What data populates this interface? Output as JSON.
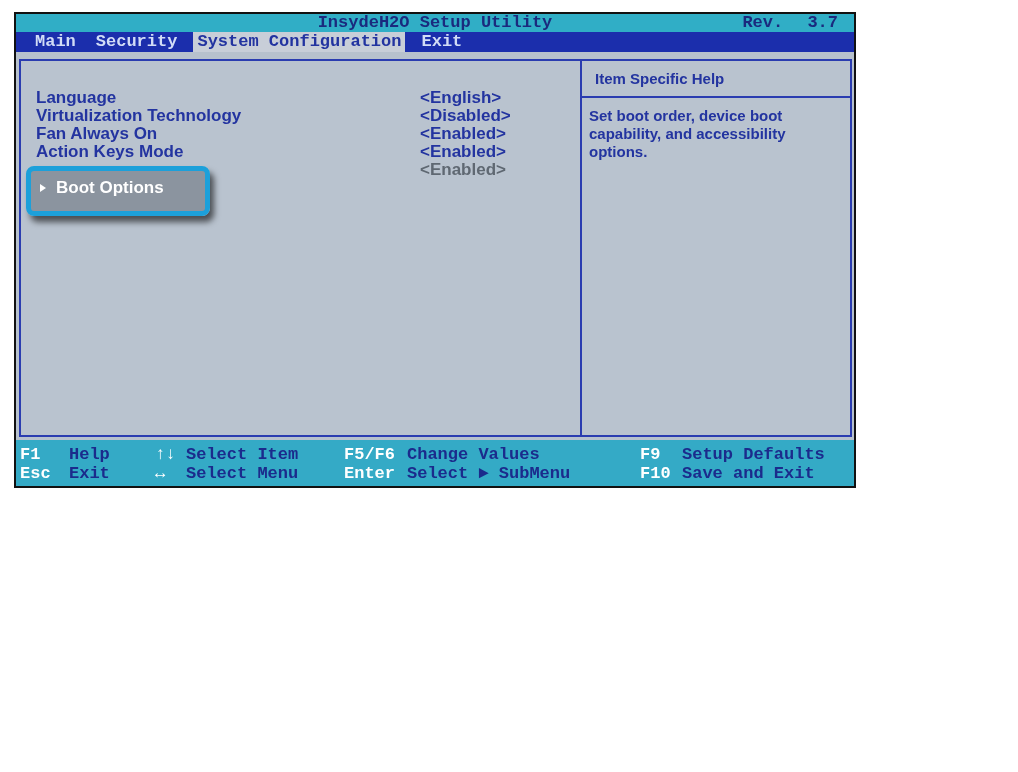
{
  "title_bar": {
    "title": "InsydeH2O Setup Utility",
    "revision": "Rev. 3.7"
  },
  "menu_tabs": [
    {
      "label": "Main",
      "selected": false
    },
    {
      "label": "Security",
      "selected": false
    },
    {
      "label": "System Configuration",
      "selected": true
    },
    {
      "label": "Exit",
      "selected": false
    }
  ],
  "settings": [
    {
      "kind": "option",
      "label": "Language",
      "value": "<English>",
      "disabled": false,
      "selected": false
    },
    {
      "kind": "option",
      "label": "Virtualization Technology",
      "value": "<Disabled>",
      "disabled": false,
      "selected": false
    },
    {
      "kind": "option",
      "label": "Fan Always On",
      "value": "<Enabled>",
      "disabled": false,
      "selected": false
    },
    {
      "kind": "option",
      "label": "Action Keys Mode",
      "value": "<Enabled>",
      "disabled": false,
      "selected": false
    },
    {
      "kind": "option",
      "value": "<Enabled>",
      "disabled": true,
      "selected": false
    },
    {
      "kind": "submenu",
      "label": "Boot Options",
      "disabled": false,
      "selected": true
    }
  ],
  "help_panel": {
    "heading": "Item Specific Help",
    "text": "Set boot order, device boot capability, and accessibility options."
  },
  "key_hints": [
    {
      "hints": [
        {
          "key": "F1",
          "action": "Help"
        },
        {
          "key": "↑↓",
          "action": "Select Item"
        },
        {
          "key": "F5/F6",
          "action": "Change Values"
        },
        {
          "key": "F9",
          "action": "Setup Defaults"
        }
      ]
    },
    {
      "hints": [
        {
          "key": "Esc",
          "action": "Exit"
        },
        {
          "key": "↔",
          "action": "Select Menu"
        },
        {
          "key": "Enter",
          "action": "Select ► SubMenu"
        },
        {
          "key": "F10",
          "action": "Save and Exit"
        }
      ]
    }
  ]
}
